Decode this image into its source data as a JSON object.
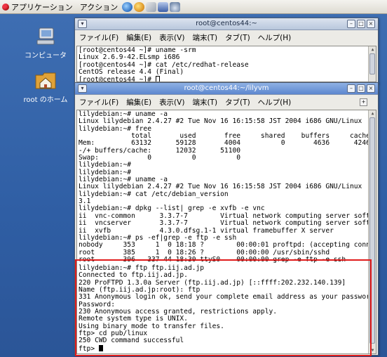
{
  "panel": {
    "menus": [
      "アプリケーション",
      "アクション"
    ],
    "launchers": [
      "globe-icon",
      "messenger-icon",
      "mail-icon",
      "editor-icon",
      "network-icon"
    ]
  },
  "desktop": {
    "icons": [
      {
        "label": "コンピュータ",
        "icon": "computer-icon"
      },
      {
        "label": "root のホーム",
        "icon": "home-folder-icon"
      }
    ]
  },
  "window_back": {
    "title": "root@centos44:~",
    "menu": [
      "ファイル(F)",
      "編集(E)",
      "表示(V)",
      "端末(T)",
      "タブ(T)",
      "ヘルプ(H)"
    ],
    "lines": [
      "[root@centos44 ~]# uname -srm",
      "Linux 2.6.9-42.ELsmp i686",
      "[root@centos44 ~]# cat /etc/redhat-release",
      "CentOS release 4.4 (Final)",
      "[root@centos44 ~]# "
    ]
  },
  "window_front": {
    "title": "root@centos44:~/lilyvm",
    "menu": [
      "ファイル(F)",
      "編集(E)",
      "表示(V)",
      "端末(T)",
      "タブ(T)",
      "ヘルプ(H)"
    ],
    "lines": [
      "lilydebian:~# uname -a",
      "Linux lilydebian 2.4.27 #2 Tue Nov 16 16:15:58 JST 2004 i686 GNU/Linux",
      "lilydebian:~# free",
      "             total       used       free     shared    buffers     cached",
      "Mem:         63132      59128       4004          0       4636      42460",
      "-/+ buffers/cache:      12032      51100",
      "Swap:            0          0          0",
      "lilydebian:~#",
      "lilydebian:~#",
      "lilydebian:~# uname -a",
      "Linux lilydebian 2.4.27 #2 Tue Nov 16 16:15:58 JST 2004 i686 GNU/Linux",
      "lilydebian:~# cat /etc/debian_version",
      "3.1",
      "lilydebian:~# dpkg --list| grep -e xvfb -e vnc",
      "ii  vnc-common      3.3.7-7        Virtual network computing server software",
      "ii  vncserver       3.3.7-7        Virtual network computing server software",
      "ii  xvfb            4.3.0.dfsg.1-1 virtual framebuffer X server",
      "lilydebian:~# ps -ef|grep -e ftp -e ssh",
      "nobody     353     1  0 18:18 ?        00:00:01 proftpd: (accepting connections)",
      "root       385     1  0 18:26 ?        00:00:00 /usr/sbin/sshd",
      "root       396   337 44 18:30 ttyS0    00:00:00 grep -e ftp -e ssh",
      "lilydebian:~# ftp ftp.iij.ad.jp",
      "Connected to ftp.iij.ad.jp.",
      "220 ProFTPD 1.3.0a Server (ftp.iij.ad.jp) [::ffff:202.232.140.139]",
      "Name (ftp.iij.ad.jp:root): ftp",
      "331 Anonymous login ok, send your complete email address as your password.",
      "Password:",
      "230 Anonymous access granted, restrictions apply.",
      "Remote system type is UNIX.",
      "Using binary mode to transfer files.",
      "ftp> cd pub/linux",
      "250 CWD command successful",
      "ftp> "
    ]
  },
  "colors": {
    "desktop": "#2f5ea4",
    "highlight": "#e01b1b",
    "active_title": "#5c87cf"
  }
}
